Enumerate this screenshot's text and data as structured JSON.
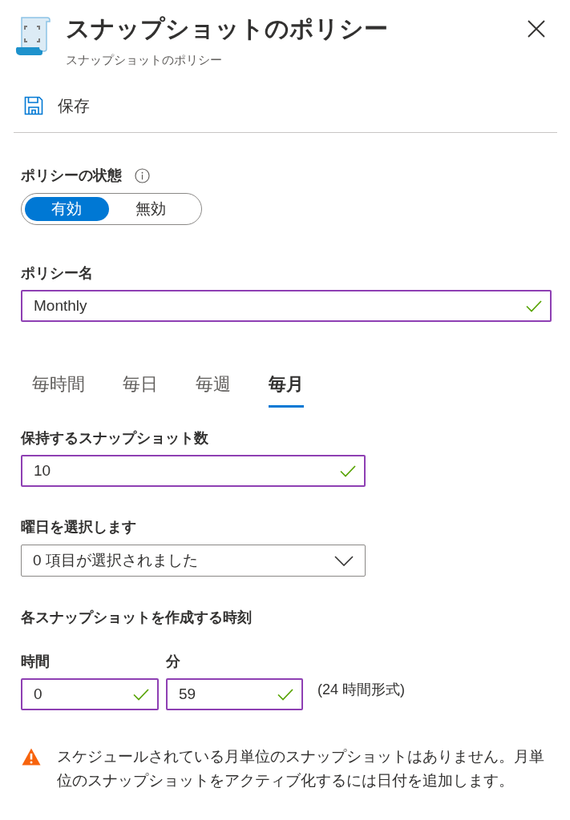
{
  "header": {
    "title": "スナップショットのポリシー",
    "subtitle": "スナップショットのポリシー"
  },
  "toolbar": {
    "save_label": "保存"
  },
  "policy_state": {
    "label": "ポリシーの状態",
    "options": [
      {
        "label": "有効",
        "selected": true
      },
      {
        "label": "無効",
        "selected": false
      }
    ]
  },
  "policy_name": {
    "label": "ポリシー名",
    "value": "Monthly",
    "valid": true
  },
  "tabs": [
    {
      "label": "毎時間",
      "selected": false
    },
    {
      "label": "毎日",
      "selected": false
    },
    {
      "label": "毎週",
      "selected": false
    },
    {
      "label": "毎月",
      "selected": true
    }
  ],
  "snapshots_to_keep": {
    "label": "保持するスナップショット数",
    "value": "10",
    "valid": true
  },
  "day_select": {
    "label": "曜日を選択します",
    "value": "0 項目が選択されました"
  },
  "time": {
    "label": "各スナップショットを作成する時刻",
    "hour": {
      "label": "時間",
      "value": "0",
      "valid": true
    },
    "minute": {
      "label": "分",
      "value": "59",
      "valid": true
    },
    "format_note": "(24 時間形式)"
  },
  "warning": {
    "message": "スケジュールされている月単位のスナップショットはありません。月単位のスナップショットをアクティブ化するには日付を追加します。"
  }
}
